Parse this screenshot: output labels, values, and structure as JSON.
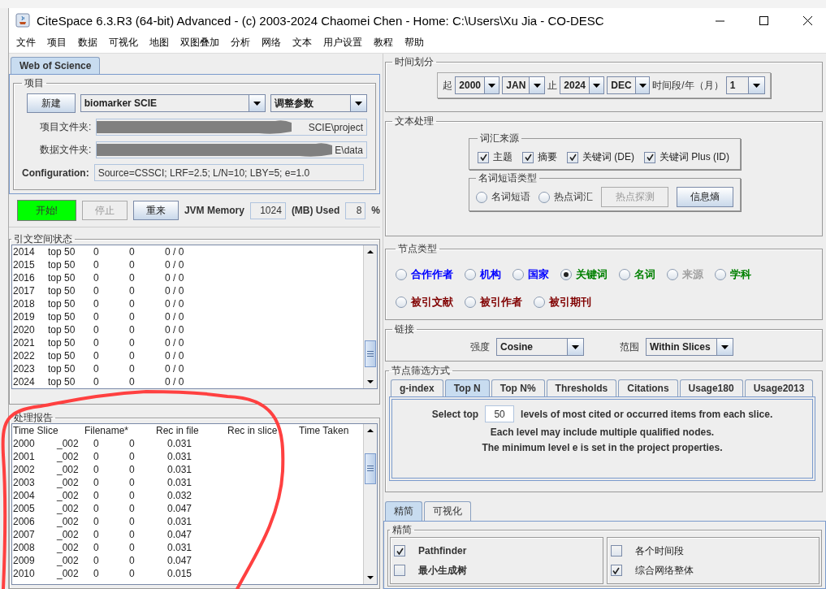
{
  "window": {
    "title": "CiteSpace 6.3.R3 (64-bit) Advanced - (c) 2003-2024 Chaomei Chen - Home: C:\\Users\\Xu Jia - CO-DESC"
  },
  "menu": [
    "文件",
    "项目",
    "数据",
    "可视化",
    "地图",
    "双图叠加",
    "分析",
    "网络",
    "文本",
    "用户设置",
    "教程",
    "帮助"
  ],
  "left_tabs": [
    {
      "label": "Web of Science",
      "selected": true
    }
  ],
  "project": {
    "title": "项目",
    "new_button": "新建",
    "project_combo": "biomarker SCIE",
    "params_combo": "调整参数",
    "project_folder_label": "项目文件夹:",
    "project_folder_value": "SCIE\\project",
    "data_folder_label": "数据文件夹:",
    "data_folder_value": "E\\data",
    "config_label": "Configuration:",
    "config_value": "Source=CSSCI; LRF=2.5; L/N=10; LBY=5; e=1.0"
  },
  "controls": {
    "start": "开始!",
    "stop": {
      "label": "停止",
      "disabled": true
    },
    "reset": "重来",
    "memory_label": "JVM Memory",
    "memory_value": "1024",
    "used_label": "(MB) Used",
    "used_value": "8",
    "percent": "%"
  },
  "citation_status": {
    "title": "引文空间状态",
    "rows": [
      [
        "2014",
        "top 50",
        "0",
        "0",
        "0 / 0"
      ],
      [
        "2015",
        "top 50",
        "0",
        "0",
        "0 / 0"
      ],
      [
        "2016",
        "top 50",
        "0",
        "0",
        "0 / 0"
      ],
      [
        "2017",
        "top 50",
        "0",
        "0",
        "0 / 0"
      ],
      [
        "2018",
        "top 50",
        "0",
        "0",
        "0 / 0"
      ],
      [
        "2019",
        "top 50",
        "0",
        "0",
        "0 / 0"
      ],
      [
        "2020",
        "top 50",
        "0",
        "0",
        "0 / 0"
      ],
      [
        "2021",
        "top 50",
        "0",
        "0",
        "0 / 0"
      ],
      [
        "2022",
        "top 50",
        "0",
        "0",
        "0 / 0"
      ],
      [
        "2023",
        "top 50",
        "0",
        "0",
        "0 / 0"
      ],
      [
        "2024",
        "top 50",
        "0",
        "0",
        "0 / 0"
      ]
    ]
  },
  "report": {
    "title": "处理报告",
    "header": [
      "Time Slice",
      "Filename*",
      "Rec in file",
      "Rec in slice",
      "Time Taken"
    ],
    "lines": [
      [
        "2000",
        "_002",
        "0",
        "0",
        "0.031"
      ],
      [
        "2001",
        "_002",
        "0",
        "0",
        "0.031"
      ],
      [
        "2002",
        "_002",
        "0",
        "0",
        "0.031"
      ],
      [
        "2003",
        "_002",
        "0",
        "0",
        "0.031"
      ],
      [
        "2004",
        "_002",
        "0",
        "0",
        "0.032"
      ],
      [
        "2005",
        "_002",
        "0",
        "0",
        "0.047"
      ],
      [
        "2006",
        "_002",
        "0",
        "0",
        "0.031"
      ],
      [
        "2007",
        "_002",
        "0",
        "0",
        "0.047"
      ],
      [
        "2008",
        "_002",
        "0",
        "0",
        "0.031"
      ],
      [
        "2009",
        "_002",
        "0",
        "0",
        "0.047"
      ],
      [
        "2010",
        "_002",
        "0",
        "0",
        "0.015"
      ]
    ]
  },
  "time_slicing": {
    "title": "时间划分",
    "from_label": "起",
    "from_year": "2000",
    "from_month": "JAN",
    "to_label": "止",
    "to_year": "2024",
    "to_month": "DEC",
    "slice_label": "时间段/年（月）",
    "slice_value": "1"
  },
  "text_processing": {
    "title": "文本处理",
    "term_source": {
      "title": "词汇来源",
      "options": [
        {
          "label": "主题",
          "checked": true
        },
        {
          "label": "摘要",
          "checked": true
        },
        {
          "label": "关键词 (DE)",
          "checked": true
        },
        {
          "label": "关键词 Plus (ID)",
          "checked": true
        }
      ]
    },
    "term_type": {
      "title": "名词短语类型",
      "options": [
        {
          "label": "名词短语",
          "selected": false
        },
        {
          "label": "热点词汇",
          "selected": false
        }
      ],
      "buttons": [
        {
          "label": "热点探测",
          "disabled": true
        },
        {
          "label": "信息熵",
          "disabled": false
        }
      ]
    }
  },
  "node_types": {
    "title": "节点类型",
    "rows": [
      {
        "options": [
          {
            "label": "合作作者",
            "selected": false,
            "disabled": false,
            "color": "#0000ff"
          },
          {
            "label": "机构",
            "selected": false,
            "disabled": false,
            "color": "#0000ff"
          },
          {
            "label": "国家",
            "selected": false,
            "disabled": false,
            "color": "#0000ff"
          },
          {
            "label": "关键词",
            "selected": true,
            "disabled": false,
            "color": "#008000"
          },
          {
            "label": "名词",
            "selected": false,
            "disabled": false,
            "color": "#008000"
          },
          {
            "label": "来源",
            "selected": false,
            "disabled": true
          },
          {
            "label": "学科",
            "selected": false,
            "disabled": false,
            "color": "#008000"
          }
        ]
      },
      {
        "options": [
          {
            "label": "被引文献",
            "selected": false,
            "disabled": false,
            "color": "#800000"
          },
          {
            "label": "被引作者",
            "selected": false,
            "disabled": false,
            "color": "#800000"
          },
          {
            "label": "被引期刊",
            "selected": false,
            "disabled": false,
            "color": "#800000"
          }
        ]
      }
    ]
  },
  "links": {
    "title": "链接",
    "strength_label": "强度",
    "strength": "Cosine",
    "scope_label": "范围",
    "scope": "Within Slices"
  },
  "selection": {
    "title": "节点筛选方式",
    "tabs": [
      {
        "label": "g-index",
        "selected": false
      },
      {
        "label": "Top N",
        "selected": true
      },
      {
        "label": "Top N%",
        "selected": false
      },
      {
        "label": "Thresholds",
        "selected": false
      },
      {
        "label": "Citations",
        "selected": false
      },
      {
        "label": "Usage180",
        "selected": false
      },
      {
        "label": "Usage2013",
        "selected": false
      }
    ],
    "select_label": "Select top",
    "top_n": "50",
    "select_suffix": "levels of most cited or occurred items from each slice.",
    "notes": [
      "Each level may include multiple qualified nodes.",
      "The minimum level e is set in the project properties."
    ]
  },
  "pruning": {
    "tabs": [
      {
        "label": "精简",
        "selected": true
      },
      {
        "label": "可视化",
        "selected": false
      }
    ],
    "title": "精简",
    "left": [
      {
        "label": "Pathfinder",
        "checked": true
      },
      {
        "label": "最小生成树",
        "checked": false
      }
    ],
    "right": [
      {
        "label": "各个时间段",
        "checked": false
      },
      {
        "label": "综合网络整体",
        "checked": true
      }
    ]
  }
}
